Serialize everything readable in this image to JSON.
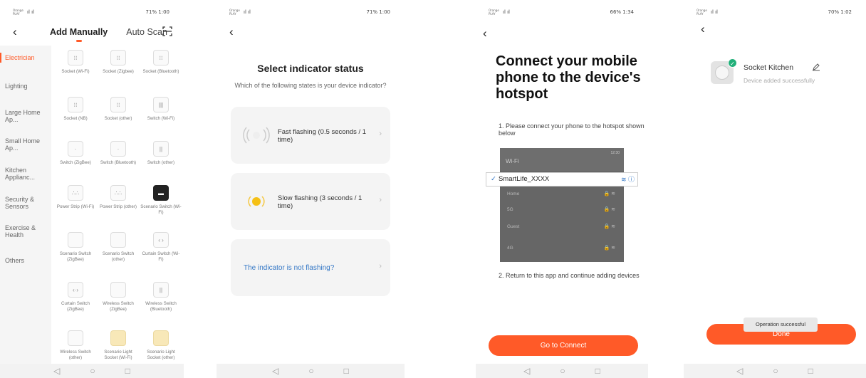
{
  "status": {
    "carrier": "Orange PLAY",
    "signal": "ıl ıl",
    "p1_right": "71% 1:00",
    "p2_right": "71% 1:00",
    "p3_right": "66% 1:34",
    "p4_right": "70% 1:02"
  },
  "icons": {
    "back": "‹",
    "nav_back": "◁",
    "nav_home": "○",
    "nav_recent": "□",
    "chevron": "›"
  },
  "screen1": {
    "tab_manual": "Add Manually",
    "tab_scan": "Auto Scan",
    "sidebar": [
      "Electrician",
      "Lighting",
      "Large Home Ap...",
      "Small Home Ap...",
      "Kitchen Applianc...",
      "Security & Sensors",
      "Exercise & Health",
      "Others"
    ],
    "devices": [
      "Socket (Wi-Fi)",
      "Socket (Zigbee)",
      "Socket (Bluetooth)",
      "Socket (NB)",
      "Socket (other)",
      "Switch (Wi-Fi)",
      "Switch (ZigBee)",
      "Switch (Bluetooth)",
      "Switch (other)",
      "Power Strip (Wi-Fi)",
      "Power Strip (other)",
      "Scenario Switch (Wi-Fi)",
      "Scenario Switch (ZigBee)",
      "Scenario Switch (other)",
      "Curtain Switch (Wi-Fi)",
      "Curtain Switch (ZigBee)",
      "Wireless Switch (ZigBee)",
      "Wireless Switch (Bluetooth)",
      "Wireless Switch (other)",
      "Scenario Light Socket (Wi-Fi)",
      "Scenario Light Socket (other)"
    ]
  },
  "screen2": {
    "title": "Select indicator status",
    "subtitle": "Which of the following states is your device indicator?",
    "fast": "Fast flashing (0.5 seconds / 1 time)",
    "slow": "Slow flashing (3 seconds / 1 time)",
    "not_flashing": "The indicator is not flashing?"
  },
  "screen3": {
    "title": "Connect your mobile phone to the device's hotspot",
    "step1": "1. Please connect your phone to the hotspot shown below",
    "wifi_header": "Wi-Fi",
    "wifi_time": "12:30",
    "selected_network": "SmartLife_XXXX",
    "networks": [
      "Home",
      "5G",
      "Guest",
      "4G"
    ],
    "step2": "2. Return to this app and continue adding devices",
    "button": "Go to Connect"
  },
  "screen4": {
    "device_name": "Socket Kitchen",
    "device_status": "Device added successfully",
    "toast": "Operation successful",
    "button": "Done"
  },
  "colors": {
    "accent": "#ff5a28",
    "link": "#3578c6",
    "success": "#22b07a"
  }
}
